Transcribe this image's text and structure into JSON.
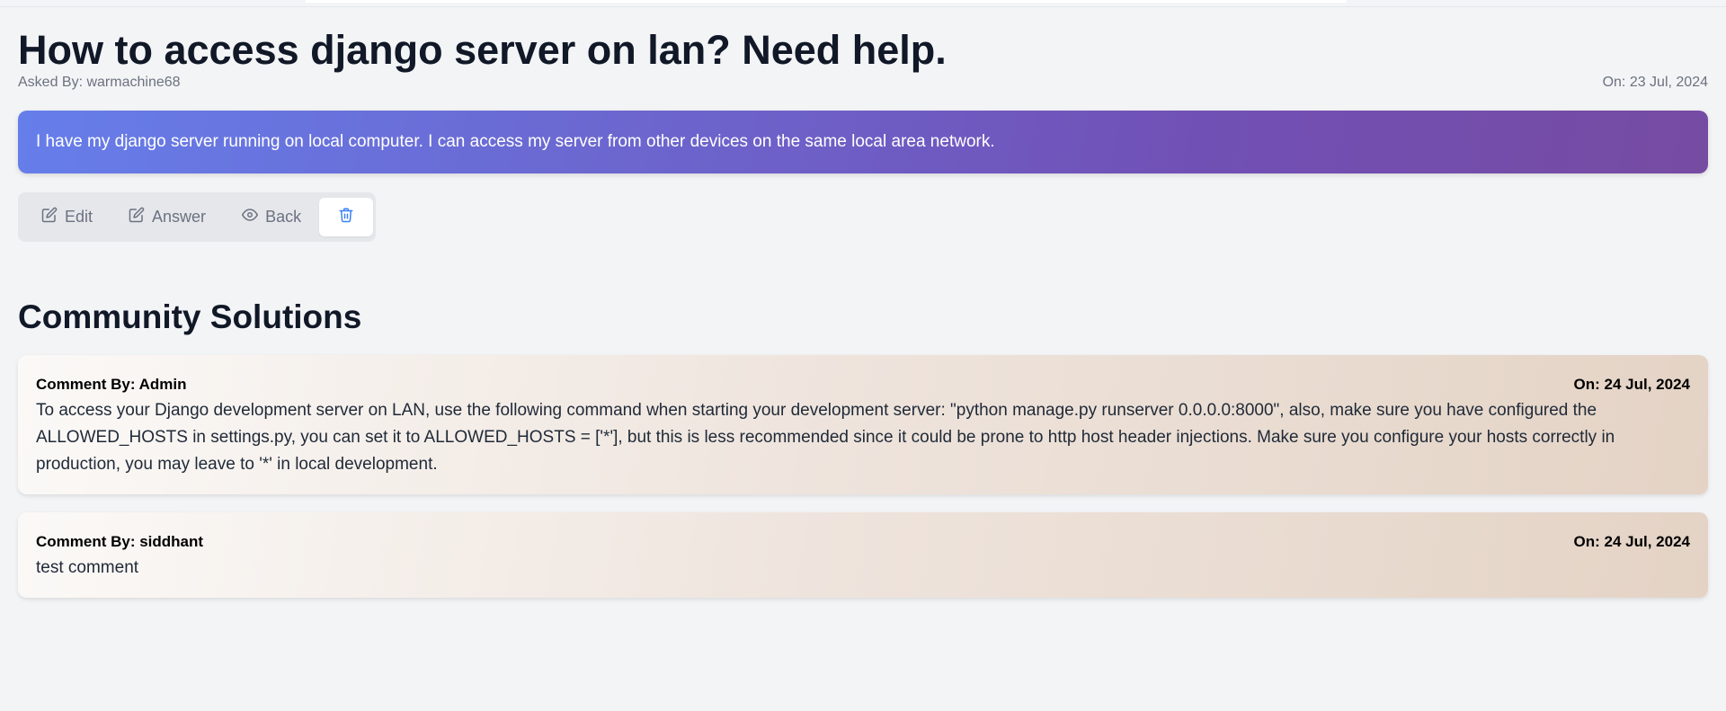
{
  "question": {
    "title": "How to access django server on lan? Need help.",
    "asked_by": "Asked By: warmachine68",
    "date": "On: 23 Jul, 2024",
    "body": "I have my django server running on local computer. I can access my server from other devices on the same local area network."
  },
  "toolbar": {
    "edit_label": "Edit",
    "answer_label": "Answer",
    "back_label": "Back",
    "delete_icon": "trash-icon"
  },
  "solutions": {
    "heading": "Community Solutions",
    "comments": [
      {
        "author": "Comment By: Admin",
        "date": "On: 24 Jul, 2024",
        "text": "To access your Django development server on LAN, use the following command when starting your development server: \"python manage.py runserver 0.0.0.0:8000\", also, make sure you have configured the ALLOWED_HOSTS in settings.py, you can set it to ALLOWED_HOSTS = ['*'], but this is less recommended since it could be prone to http host header injections. Make sure you configure your hosts correctly in production, you may leave to '*' in local development."
      },
      {
        "author": "Comment By: siddhant",
        "date": "On: 24 Jul, 2024",
        "text": "test comment"
      }
    ]
  },
  "colors": {
    "question_gradient_start": "#667eea",
    "question_gradient_end": "#764ba2",
    "delete_icon": "#3b82f6"
  }
}
